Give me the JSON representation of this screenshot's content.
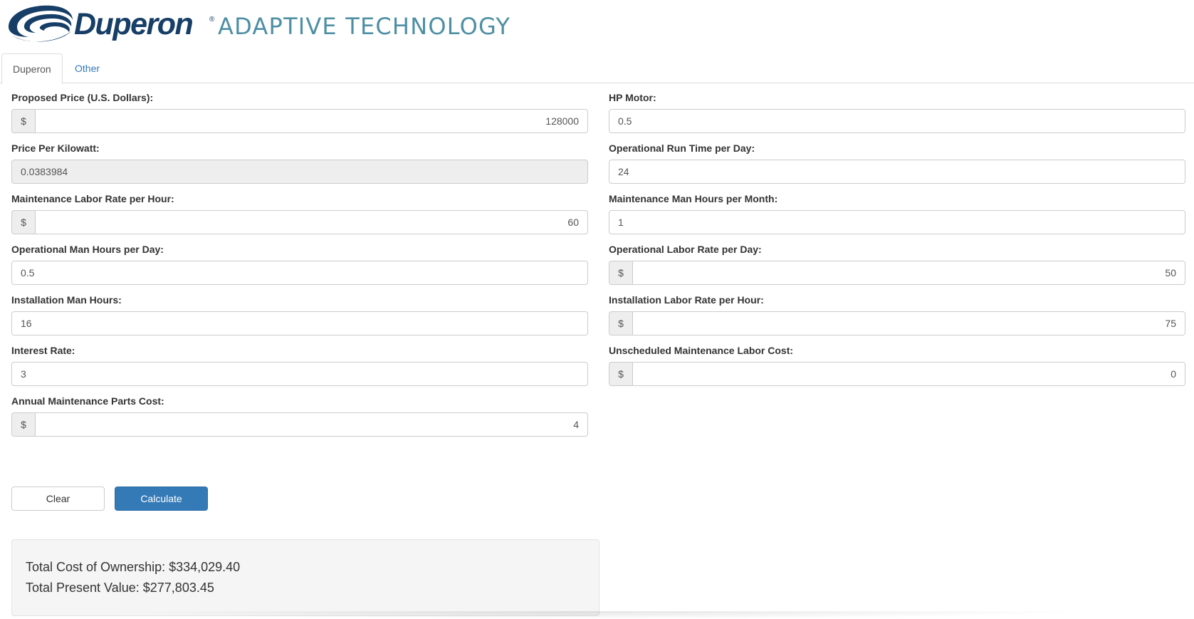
{
  "brand": {
    "name": "Duperon",
    "registered": "®",
    "tagline": "ADAPTIVE TECHNOLOGY",
    "colors": {
      "primary": "#163e66",
      "secondary": "#4e8fa3"
    }
  },
  "tabs": [
    {
      "label": "Duperon",
      "active": true
    },
    {
      "label": "Other",
      "active": false
    }
  ],
  "form": {
    "proposed_price": {
      "label": "Proposed Price (U.S. Dollars):",
      "addon": "$",
      "value": "128000"
    },
    "price_per_kw": {
      "label": "Price Per Kilowatt:",
      "value": "0.0383984",
      "readonly": true
    },
    "maint_labor_rate": {
      "label": "Maintenance Labor Rate per Hour:",
      "addon": "$",
      "value": "60"
    },
    "op_man_hours": {
      "label": "Operational Man Hours per Day:",
      "value": "0.5"
    },
    "install_man_hours": {
      "label": "Installation Man Hours:",
      "value": "16"
    },
    "interest_rate": {
      "label": "Interest Rate:",
      "value": "3"
    },
    "annual_parts_cost": {
      "label": "Annual Maintenance Parts Cost:",
      "addon": "$",
      "value": "4"
    },
    "hp_motor": {
      "label": "HP Motor:",
      "value": "0.5"
    },
    "op_run_time": {
      "label": "Operational Run Time per Day:",
      "value": "24"
    },
    "maint_man_hours": {
      "label": "Maintenance Man Hours per Month:",
      "value": "1"
    },
    "op_labor_rate": {
      "label": "Operational Labor Rate per Day:",
      "addon": "$",
      "value": "50"
    },
    "install_labor_rate": {
      "label": "Installation Labor Rate per Hour:",
      "addon": "$",
      "value": "75"
    },
    "unsched_labor_cost": {
      "label": "Unscheduled Maintenance Labor Cost:",
      "addon": "$",
      "value": "0"
    }
  },
  "buttons": {
    "clear": "Clear",
    "calculate": "Calculate"
  },
  "results": {
    "total_cost": "Total Cost of Ownership: $334,029.40",
    "total_pv": "Total Present Value: $277,803.45"
  },
  "colors": {
    "accent": "#337ab7",
    "label": "#333333",
    "readonly_bg": "#eeeeee",
    "results_bg": "#f5f5f5"
  }
}
